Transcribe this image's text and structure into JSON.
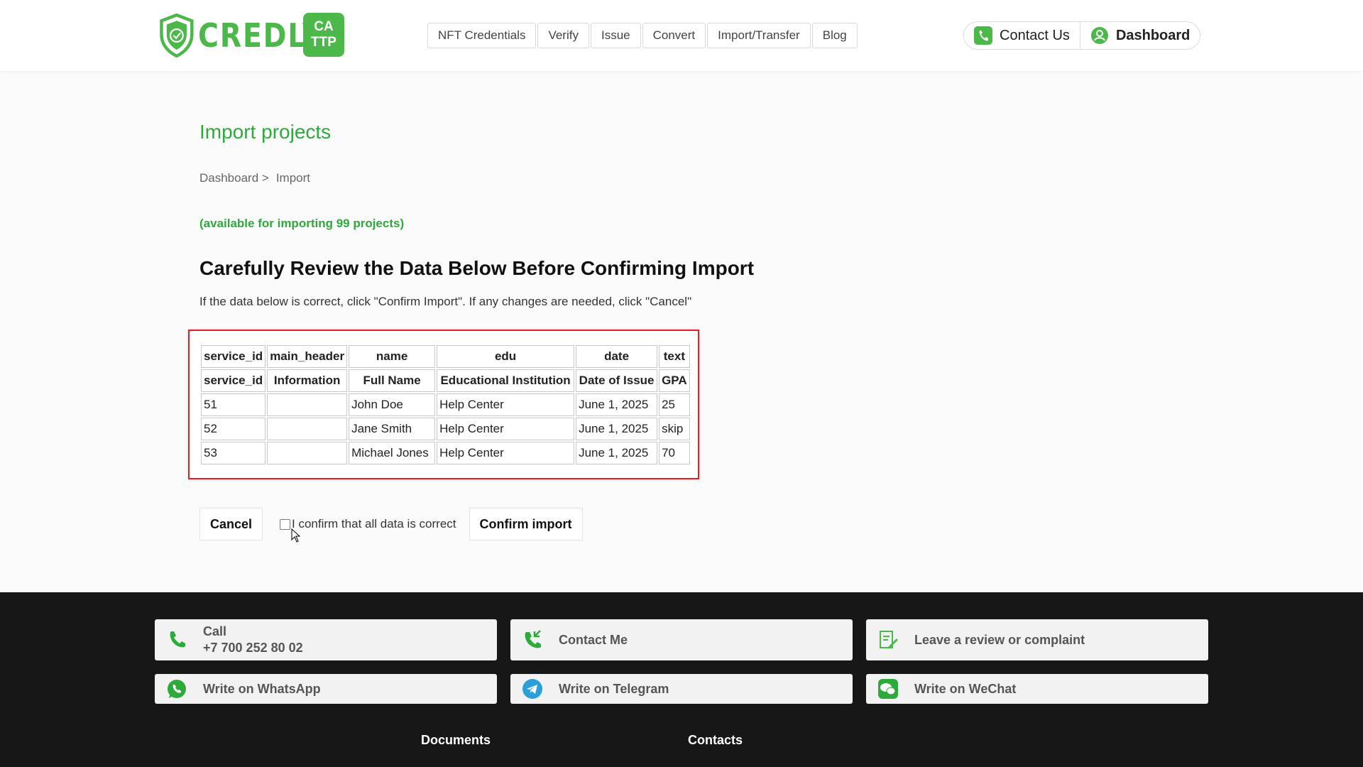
{
  "brand": {
    "name": "CREDLY",
    "badge_top": "CA",
    "badge_bottom": "TTP",
    "color": "#4cb84a"
  },
  "nav": [
    "NFT Credentials",
    "Verify",
    "Issue",
    "Convert",
    "Import/Transfer",
    "Blog"
  ],
  "header_actions": {
    "contact": "Contact Us",
    "dashboard": "Dashboard"
  },
  "page": {
    "title": "Import projects",
    "breadcrumb": [
      "Dashboard >",
      "Import"
    ],
    "available": "(available for importing 99 projects)",
    "review_title": "Carefully Review the Data Below Before Confirming Import",
    "review_sub": "If the data below is correct, click \"Confirm Import\". If any changes are needed, click \"Cancel\""
  },
  "table": {
    "header_row_1": [
      "service_id",
      "main_header",
      "name",
      "edu",
      "date",
      "text"
    ],
    "header_row_2": [
      "service_id",
      "Information",
      "Full Name",
      "Educational Institution",
      "Date of Issue",
      "GPA"
    ],
    "rows": [
      [
        "51",
        "",
        "John Doe",
        "Help Center",
        "June 1, 2025",
        "25"
      ],
      [
        "52",
        "",
        "Jane Smith",
        "Help Center",
        "June 1, 2025",
        "skip"
      ],
      [
        "53",
        "",
        "Michael Jones",
        "Help Center",
        "June 1, 2025",
        "70"
      ]
    ]
  },
  "actions": {
    "cancel": "Cancel",
    "confirm_checkbox": "I confirm that all data is correct",
    "confirm": "Confirm import",
    "checkbox_checked": false
  },
  "footer": {
    "call_label": "Call",
    "call_number": "+7 700 252 80 02",
    "contact_me": "Contact Me",
    "review": "Leave a review or complaint",
    "whatsapp": "Write on WhatsApp",
    "telegram": "Write on Telegram",
    "wechat": "Write on WeChat",
    "documents": "Documents",
    "contacts": "Contacts"
  },
  "colors": {
    "accent": "#2eaa3c",
    "highlight_border": "#e3202a",
    "footer_bg": "#171717",
    "telegram": "#2a9fd8"
  }
}
